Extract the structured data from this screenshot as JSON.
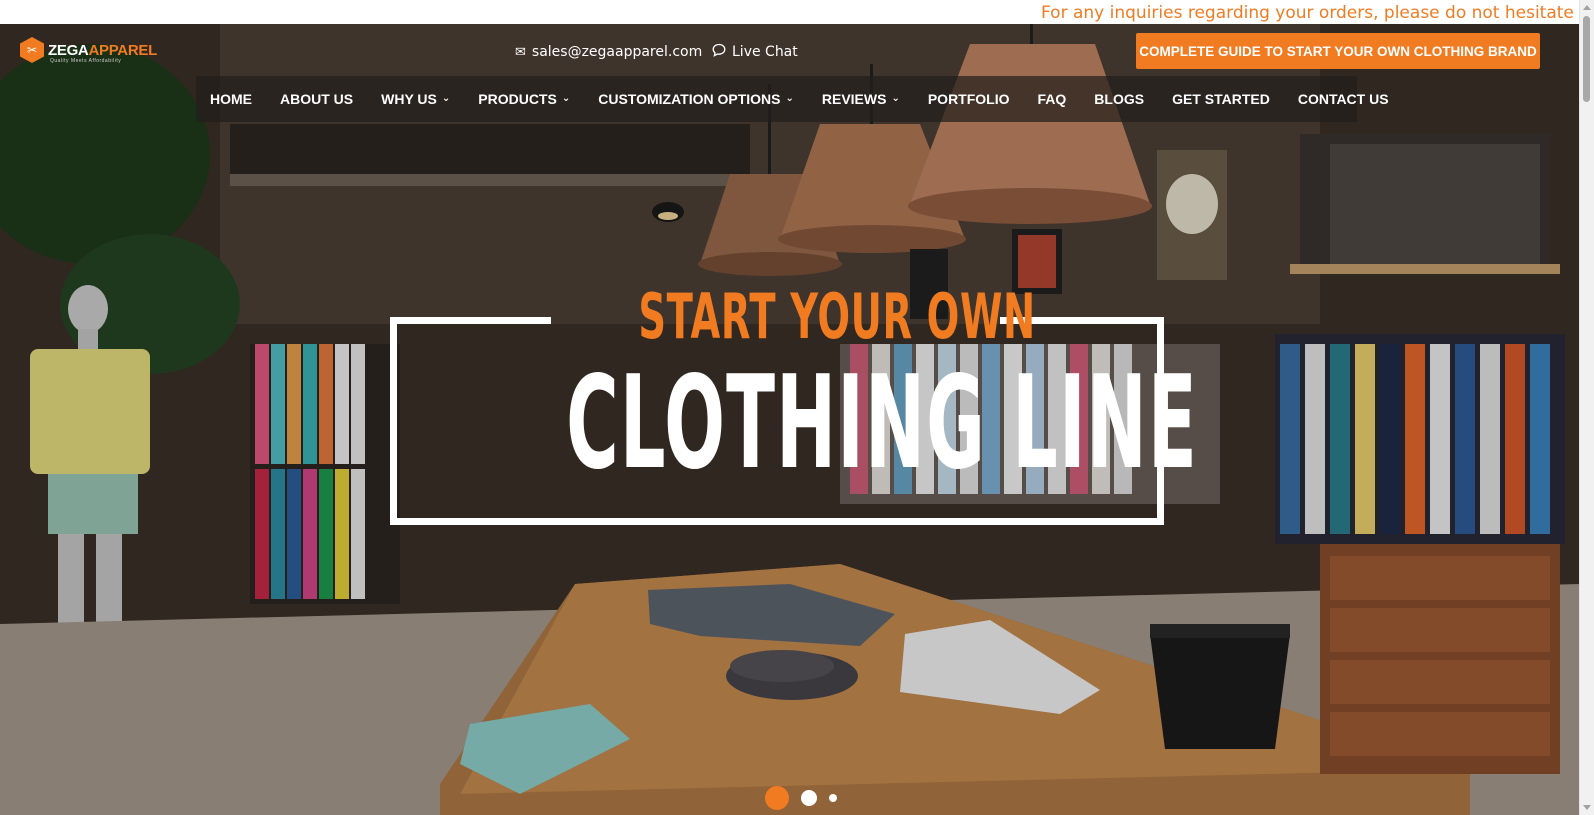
{
  "top_banner": {
    "text": "For any inquiries regarding your orders, please do not hesitate to contac"
  },
  "header": {
    "logo": {
      "brand_part1": "ZEGA",
      "brand_part2": "APPAREL",
      "tagline": "Quality Meets Affordability"
    },
    "email": "sales@zegaapparel.com",
    "live_chat": "Live Chat",
    "cta_label": "COMPLETE GUIDE TO START YOUR OWN CLOTHING BRAND"
  },
  "nav": {
    "items": [
      {
        "label": "HOME",
        "dropdown": false
      },
      {
        "label": "ABOUT US",
        "dropdown": false
      },
      {
        "label": "WHY US",
        "dropdown": true
      },
      {
        "label": "PRODUCTS",
        "dropdown": true
      },
      {
        "label": "CUSTOMIZATION OPTIONS",
        "dropdown": true
      },
      {
        "label": "REVIEWS",
        "dropdown": true
      },
      {
        "label": "PORTFOLIO",
        "dropdown": false
      },
      {
        "label": "FAQ",
        "dropdown": false
      },
      {
        "label": "BLOGS",
        "dropdown": false
      },
      {
        "label": "GET STARTED",
        "dropdown": false
      },
      {
        "label": "CONTACT US",
        "dropdown": false
      }
    ]
  },
  "hero": {
    "headline_top": "START YOUR OWN",
    "headline_main": "CLOTHING LINE",
    "slides_count": 3,
    "active_slide": 1
  },
  "colors": {
    "accent": "#f07b21",
    "text_light": "#ffffff",
    "nav_bg": "#231e1c"
  },
  "icons": {
    "email": "envelope-icon",
    "chat": "chat-bubble-icon",
    "dropdown": "chevron-down-icon"
  }
}
